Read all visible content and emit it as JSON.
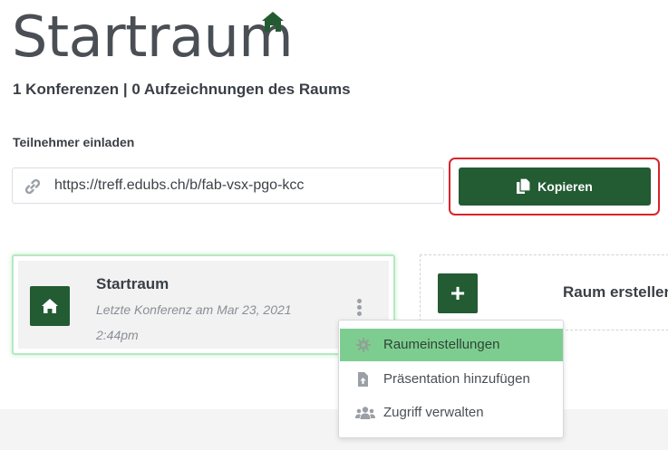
{
  "page": {
    "title": "Startraum",
    "subtitle": "1 Konferenzen | 0 Aufzeichnungen des Raums"
  },
  "invite": {
    "label": "Teilnehmer einladen",
    "url": "https://treff.edubs.ch/b/fab-vsx-pgo-kcc",
    "copy_button": "Kopieren"
  },
  "room_card": {
    "name": "Startraum",
    "last_conference": "Letzte Konferenz am Mar 23, 2021 2:44pm"
  },
  "create_room": {
    "label": "Raum erstellen"
  },
  "context_menu": {
    "items": [
      {
        "label": "Raumeinstellungen",
        "icon": "gear-icon",
        "active": true
      },
      {
        "label": "Präsentation hinzufügen",
        "icon": "file-upload-icon",
        "active": false
      },
      {
        "label": "Zugriff verwalten",
        "icon": "users-icon",
        "active": false
      }
    ]
  },
  "colors": {
    "primary_green": "#235b33",
    "highlight_red": "#d9232b",
    "menu_active": "#7ecd90"
  }
}
